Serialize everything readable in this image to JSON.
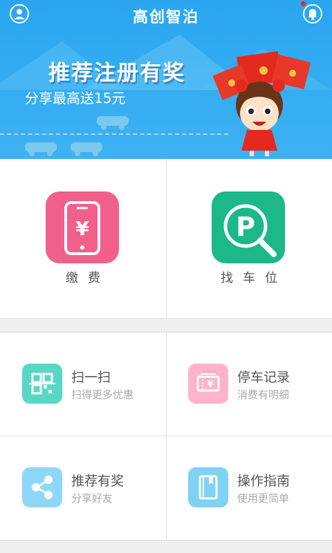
{
  "app": {
    "title": "高创智泊"
  },
  "banner": {
    "title": "推荐注册有奖",
    "subtitle": "分享最高送15元"
  },
  "main_actions": [
    {
      "label": "缴费",
      "icon": "phone-yuan-icon",
      "color": "#f0608b"
    },
    {
      "label": "找车位",
      "icon": "parking-search-icon",
      "color": "#1cb887"
    }
  ],
  "features": [
    {
      "title": "扫一扫",
      "subtitle": "扫得更多优惠",
      "icon": "qr-scan-icon",
      "color": "#58d8c4"
    },
    {
      "title": "停车记录",
      "subtitle": "消费有明细",
      "icon": "ticket-icon",
      "color": "#ffb2cb"
    },
    {
      "title": "推荐有奖",
      "subtitle": "分享好友",
      "icon": "share-icon",
      "color": "#8ed7f9"
    },
    {
      "title": "操作指南",
      "subtitle": "使用更简单",
      "icon": "guide-book-icon",
      "color": "#7fd2f3"
    }
  ]
}
